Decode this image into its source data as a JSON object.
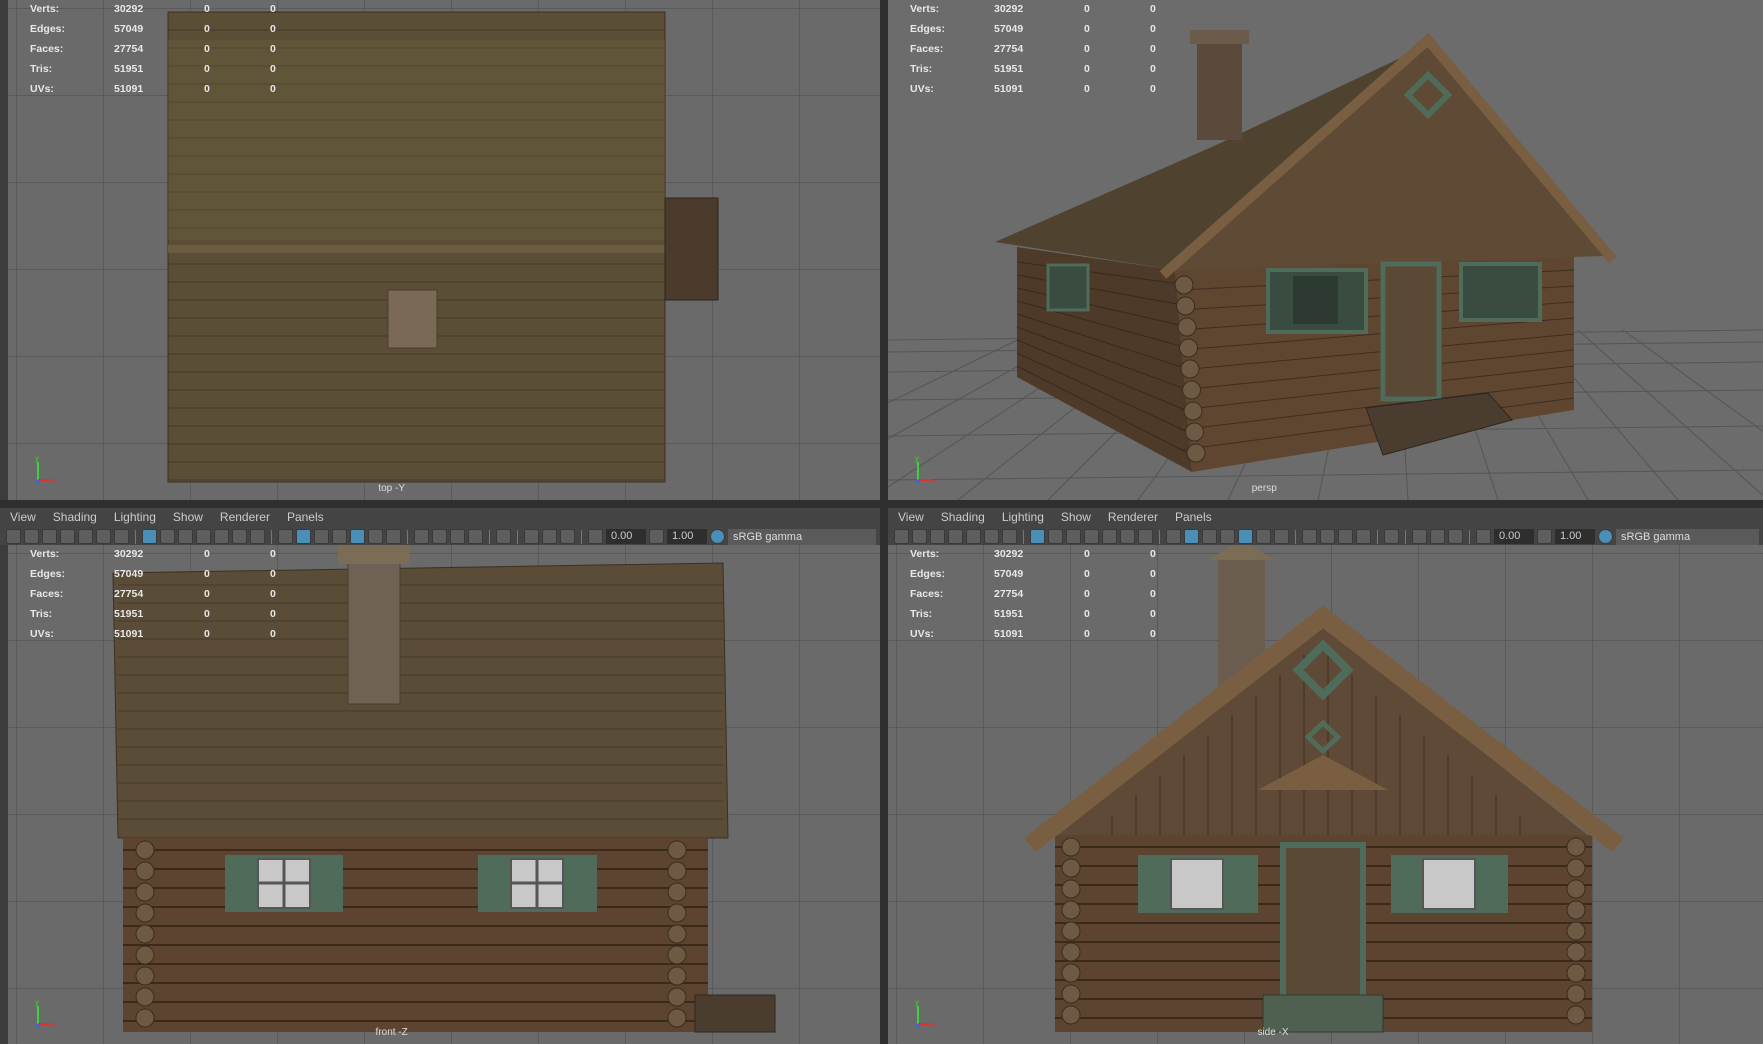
{
  "menu": [
    "View",
    "Shading",
    "Lighting",
    "Show",
    "Renderer",
    "Panels"
  ],
  "toolbar": {
    "exposure": "0.00",
    "gamma": "1.00",
    "color_space": "sRGB gamma"
  },
  "hud": {
    "rows": [
      {
        "label": "Verts:",
        "value": "30292",
        "a": "0",
        "b": "0"
      },
      {
        "label": "Edges:",
        "value": "57049",
        "a": "0",
        "b": "0"
      },
      {
        "label": "Faces:",
        "value": "27754",
        "a": "0",
        "b": "0"
      },
      {
        "label": "Tris:",
        "value": "51951",
        "a": "0",
        "b": "0"
      },
      {
        "label": "UVs:",
        "value": "51091",
        "a": "0",
        "b": "0"
      }
    ]
  },
  "viewports": [
    {
      "id": "top",
      "camera": "top -Y"
    },
    {
      "id": "persp",
      "camera": "persp"
    },
    {
      "id": "front",
      "camera": "front -Z"
    },
    {
      "id": "side",
      "camera": "side -X"
    }
  ],
  "gizmo": {
    "y": "y",
    "x": "x",
    "z": "z"
  },
  "colors": {
    "viewport": "#6a6a6a",
    "toolbar": "#444444",
    "active": "#4a8fb8",
    "roof": "#5b4e36",
    "logs": "#5a4330",
    "trim": "#4f6b5a"
  }
}
